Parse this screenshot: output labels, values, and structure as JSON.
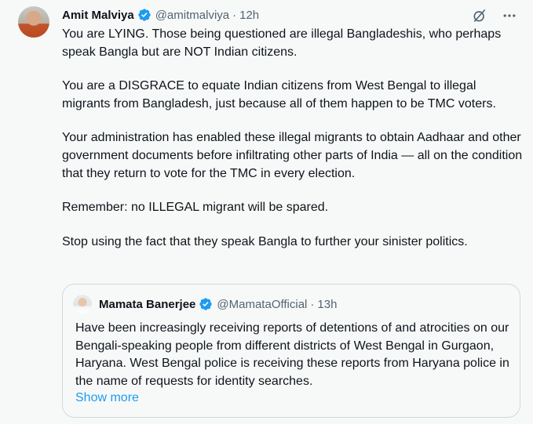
{
  "author": {
    "name": "Amit Malviya",
    "handle": "@amitmalviya",
    "separator": "·",
    "time": "12h"
  },
  "tweet": {
    "paragraphs": [
      "You are LYING. Those being questioned are illegal Bangladeshis, who perhaps speak Bangla but are NOT Indian citizens.",
      "You are a DISGRACE to equate Indian citizens from West Bengal to illegal migrants from Bangladesh, just because all of them happen to be TMC voters.",
      "Your administration has enabled these illegal migrants to obtain Aadhaar and other government documents before infiltrating other parts of India — all on the condition that they return to vote for the TMC in every election.",
      "Remember: no ILLEGAL migrant will be spared.",
      "Stop using the fact that they speak Bangla to further your sinister politics."
    ]
  },
  "quote": {
    "name": "Mamata Banerjee",
    "handle": "@MamataOfficial",
    "separator": "·",
    "time": "13h",
    "text": "Have been increasingly receiving reports of detentions of and atrocities on our Bengali-speaking people from different districts of West Bengal in Gurgaon, Haryana. West Bengal police is receiving these reports from Haryana police in the name of requests for identity searches.",
    "show_more": "Show more"
  },
  "icons": {
    "verified": "verified-badge-icon",
    "grok": "grok-icon",
    "more": "more-icon"
  },
  "colors": {
    "accent": "#1d9bf0",
    "secondary_text": "#536471",
    "background": "#f7f9f9"
  }
}
